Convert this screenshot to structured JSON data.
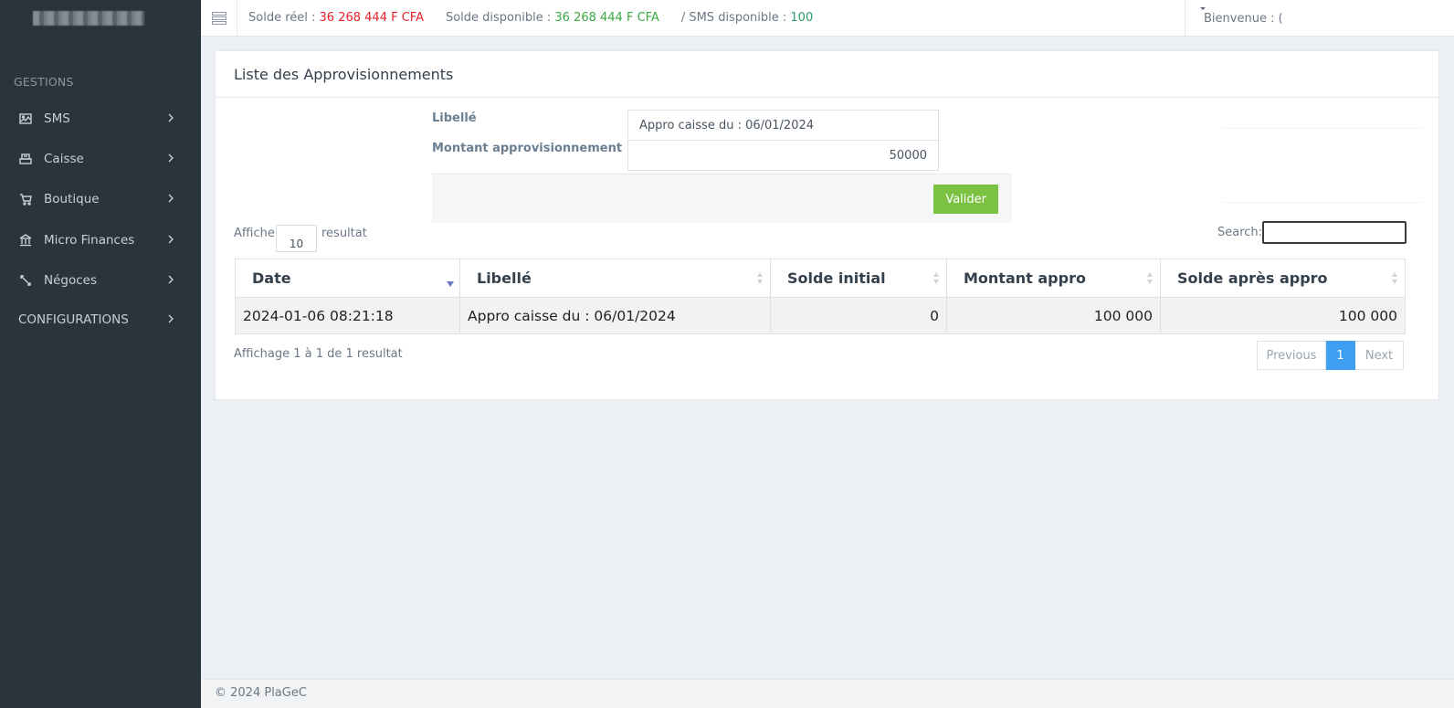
{
  "topbar": {
    "solde_reel_label": "Solde réel :",
    "solde_reel_value": "36 268 444 F CFA",
    "solde_dispo_label": "Solde disponible :",
    "solde_dispo_value": "36 268 444 F CFA",
    "sms_label": "/ SMS disponible :",
    "sms_value": "100",
    "welcome": "Bienvenue : ("
  },
  "sidebar": {
    "section": "GESTIONS",
    "items": [
      {
        "label": "SMS",
        "icon": "image-icon"
      },
      {
        "label": "Caisse",
        "icon": "cash-register-icon"
      },
      {
        "label": "Boutique",
        "icon": "cart-icon"
      },
      {
        "label": "Micro Finances",
        "icon": "bank-icon"
      },
      {
        "label": "Négoces",
        "icon": "exchange-icon"
      }
    ],
    "config": "CONFIGURATIONS"
  },
  "card": {
    "title": "Liste des Approvisionnements"
  },
  "form": {
    "libelle_label": "Libellé",
    "libelle_value": "Appro caisse du : 06/01/2024",
    "montant_label": "Montant approvisionnement",
    "montant_value": "50000",
    "submit": "Valider"
  },
  "table_controls": {
    "length_prefix": "Affiche",
    "length_value": "10",
    "length_suffix": "resultat",
    "search_label": "Search:"
  },
  "table": {
    "columns": [
      "Date",
      "Libellé",
      "Solde initial",
      "Montant appro",
      "Solde après appro"
    ],
    "rows": [
      [
        "2024-01-06 08:21:18",
        "Appro caisse du : 06/01/2024",
        "0",
        "100 000",
        "100 000"
      ]
    ]
  },
  "pagination": {
    "info": "Affichage 1 à 1 de 1 resultat",
    "previous": "Previous",
    "current": "1",
    "next": "Next"
  },
  "footer": "© 2024 PlaGeC",
  "colors": {
    "sidebar_bg": "#29343d",
    "negative": "#e8212b",
    "positive": "#3aa843",
    "button": "#7cc242",
    "page_active": "#3fa0f2"
  }
}
